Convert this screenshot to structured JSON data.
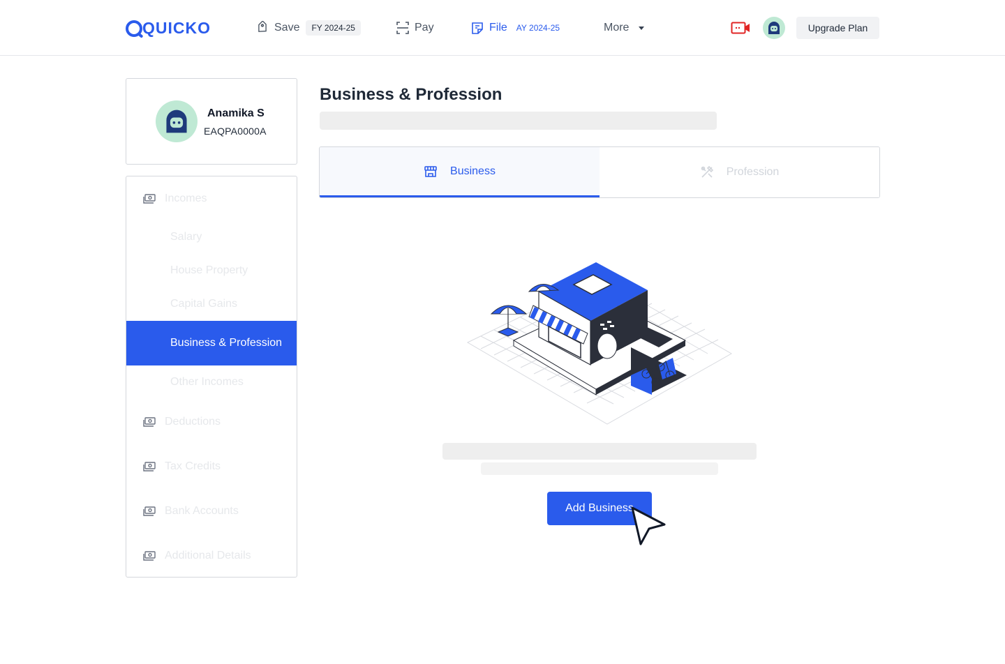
{
  "header": {
    "logo": "QUICKO",
    "nav": {
      "save_label": "Save",
      "save_badge": "FY 2024-25",
      "pay_label": "Pay",
      "file_label": "File",
      "file_badge": "AY 2024-25",
      "more_label": "More"
    },
    "upgrade_label": "Upgrade Plan"
  },
  "profile": {
    "name": "Anamika S",
    "pan": "EAQPA0000A"
  },
  "sidebar": {
    "items": [
      {
        "label": "Incomes",
        "icon": "cash-icon"
      },
      {
        "label": "Deductions",
        "icon": "cash-icon"
      },
      {
        "label": "Tax Credits",
        "icon": "cash-icon"
      },
      {
        "label": "Bank Accounts",
        "icon": "cash-icon"
      },
      {
        "label": "Additional Details",
        "icon": "cash-icon"
      }
    ],
    "income_sub": [
      {
        "label": "Salary"
      },
      {
        "label": "House Property"
      },
      {
        "label": "Capital Gains"
      },
      {
        "label": "Business & Profession",
        "active": true
      },
      {
        "label": "Other Incomes"
      }
    ]
  },
  "main": {
    "title": "Business & Profession",
    "tabs": [
      {
        "label": "Business",
        "icon": "storefront-icon",
        "active": true
      },
      {
        "label": "Profession",
        "icon": "tools-icon",
        "active": false
      }
    ],
    "add_button": "Add Business"
  },
  "colors": {
    "accent": "#2a5bec",
    "avatar_bg": "#bfe9d4",
    "video_icon": "#e02424"
  }
}
